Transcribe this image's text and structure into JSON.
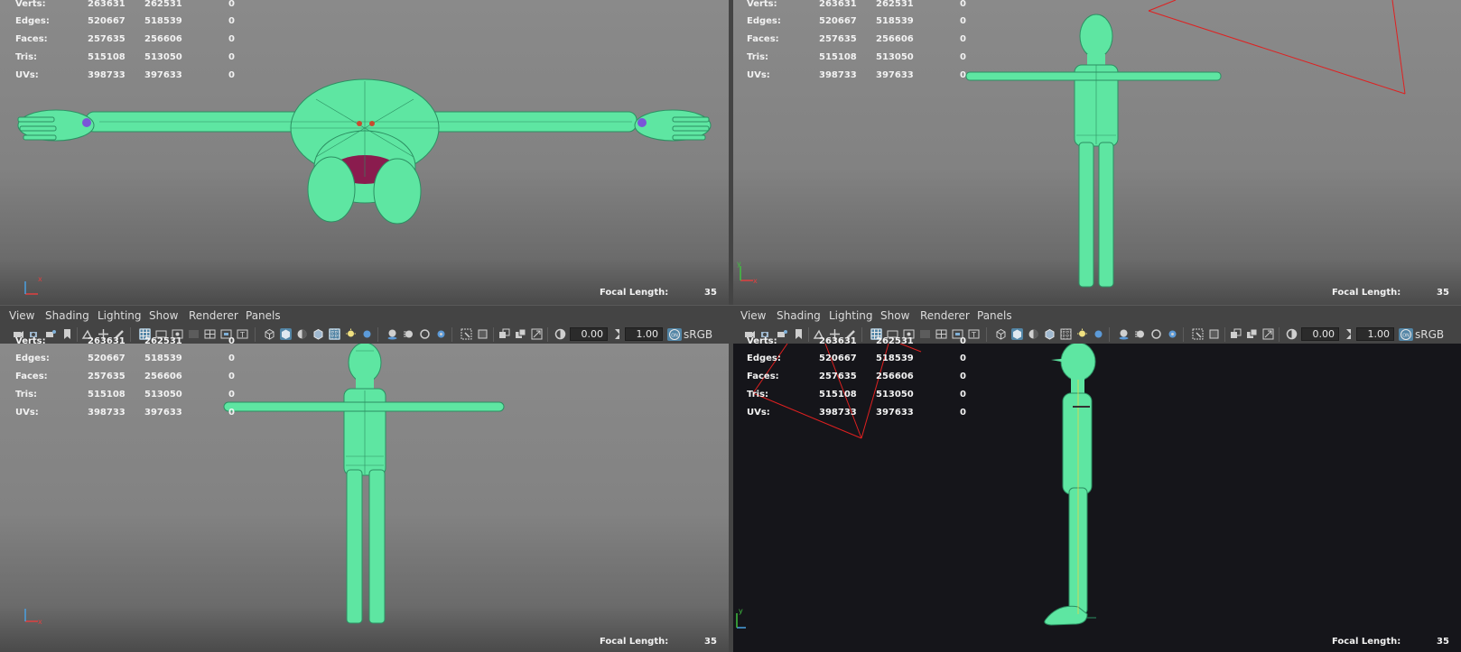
{
  "stats": {
    "rows": [
      {
        "label": "Verts:",
        "v1": "263631",
        "v2": "262531",
        "v3": "0"
      },
      {
        "label": "Edges:",
        "v1": "520667",
        "v2": "518539",
        "v3": "0"
      },
      {
        "label": "Faces:",
        "v1": "257635",
        "v2": "256606",
        "v3": "0"
      },
      {
        "label": "Tris:",
        "v1": "515108",
        "v2": "513050",
        "v3": "0"
      },
      {
        "label": "UVs:",
        "v1": "398733",
        "v2": "397633",
        "v3": "0"
      }
    ]
  },
  "focal": {
    "label": "Focal Length:",
    "value": "35"
  },
  "panel_menu": [
    "View",
    "Shading",
    "Lighting",
    "Show",
    "Renderer",
    "Panels"
  ],
  "toolbar": {
    "exposure": "0.00",
    "gamma": "1.00",
    "colorspace": "sRGB"
  },
  "axes": {
    "x": "x",
    "y": "y"
  },
  "colors": {
    "mesh": "#5ee6a2",
    "wire": "#3dbf82",
    "camera_frustum": "#e02020",
    "viewport_grey": "#868686",
    "viewport_dark": "#15151a",
    "ui_bg": "#444444",
    "highlight": "#5285a6"
  },
  "viewports": [
    {
      "name": "top",
      "background": "grey"
    },
    {
      "name": "persp",
      "background": "grey"
    },
    {
      "name": "front",
      "background": "grey"
    },
    {
      "name": "side",
      "background": "dark"
    }
  ]
}
